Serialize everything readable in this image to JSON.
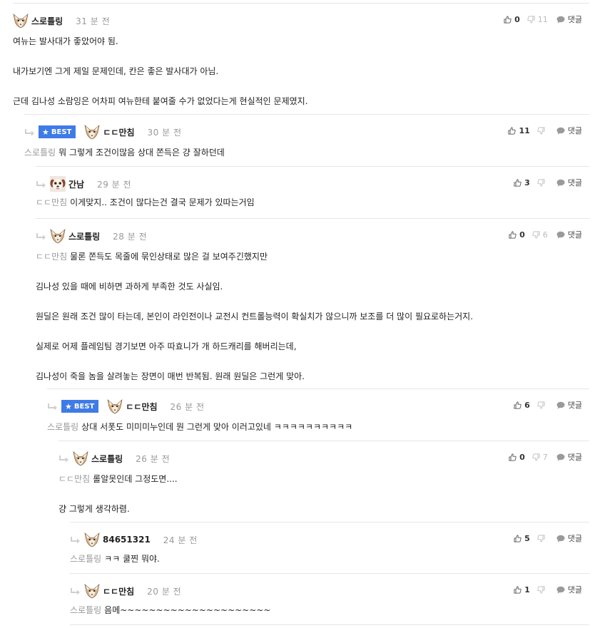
{
  "comments": [
    {
      "depth": 0,
      "best": false,
      "avatar": "fox",
      "nickname": "스로틀링",
      "time": "31 분 전",
      "likes": "0",
      "dislikes": "11",
      "reply_label": "댓글",
      "mention": "",
      "paragraphs": [
        "여뉴는 발사대가 좋았어야 됨.",
        "내가보기엔 그게 제일 문제인데, 칸은 좋은 발사대가 아님.",
        "근데 김나성 소람잉은 어차피 여뉴한테 붙여줄 수가 없었다는게 현실적인 문제였지."
      ]
    },
    {
      "depth": 1,
      "best": true,
      "best_label": "BEST",
      "avatar": "fox",
      "nickname": "ㄷㄷ만침",
      "time": "30 분 전",
      "likes": "11",
      "dislikes": "",
      "reply_label": "댓글",
      "mention": "스로틀링",
      "paragraphs": [
        "뭐 그렇게 조건이많음 상대 쫀득은 걍 잘하던데"
      ]
    },
    {
      "depth": 2,
      "best": false,
      "avatar": "dog",
      "nickname": "간남",
      "time": "29 분 전",
      "likes": "3",
      "dislikes": "",
      "reply_label": "댓글",
      "mention": "ㄷㄷ만침",
      "paragraphs": [
        "이게맞지.. 조건이 많다는건 결국 문제가 있따는거임"
      ]
    },
    {
      "depth": 2,
      "best": false,
      "avatar": "fox",
      "nickname": "스로틀링",
      "time": "28 분 전",
      "likes": "0",
      "dislikes": "6",
      "reply_label": "댓글",
      "mention": "ㄷㄷ만침",
      "paragraphs": [
        "물론 쫀득도 목줄에 묶인상태로 많은 걸 보여주긴했지만",
        "김나성 있을 때에 비하면 과하게 부족한 것도 사실임.",
        "원딜은 원래 조건 많이 타는데, 본인이 라인전이나 교전시 컨트롤능력이 확실치가 않으니까 보조를 더 많이 필요로하는거지.",
        "실제로 어제 플레임팀 경기보면 아주 따효니가 개 하드캐리를 해버리는데,",
        "김나성이 죽을 놈을 살려놓는 장면이 매번 반복됨. 원래 원딜은 그런게 맞아."
      ]
    },
    {
      "depth": 3,
      "best": true,
      "best_label": "BEST",
      "avatar": "fox",
      "nickname": "ㄷㄷ만침",
      "time": "26 분 전",
      "likes": "6",
      "dislikes": "",
      "reply_label": "댓글",
      "mention": "스로틀링",
      "paragraphs": [
        "상대 서폿도 미미미누인데 뭔 그런게 맞아 이러고있네 ㅋㅋㅋㅋㅋㅋㅋㅋㅋㅋ"
      ]
    },
    {
      "depth": 4,
      "best": false,
      "avatar": "fox",
      "nickname": "스로틀링",
      "time": "26 분 전",
      "likes": "0",
      "dislikes": "7",
      "reply_label": "댓글",
      "mention": "ㄷㄷ만침",
      "paragraphs": [
        "롤알못인데 그정도면....",
        "걍 그렇게 생각하렴."
      ]
    },
    {
      "depth": 5,
      "best": false,
      "avatar": "fox",
      "nickname": "84651321",
      "time": "24 분 전",
      "likes": "5",
      "dislikes": "",
      "reply_label": "댓글",
      "mention": "스로틀링",
      "paragraphs": [
        "ㅋㅋ 쿨찐 뭐야."
      ]
    },
    {
      "depth": 5,
      "best": false,
      "avatar": "fox",
      "nickname": "ㄷㄷ만침",
      "time": "20 분 전",
      "likes": "1",
      "dislikes": "",
      "reply_label": "댓글",
      "mention": "스로틀링",
      "paragraphs": [
        "음메~~~~~~~~~~~~~~~~~~~~~"
      ]
    }
  ]
}
